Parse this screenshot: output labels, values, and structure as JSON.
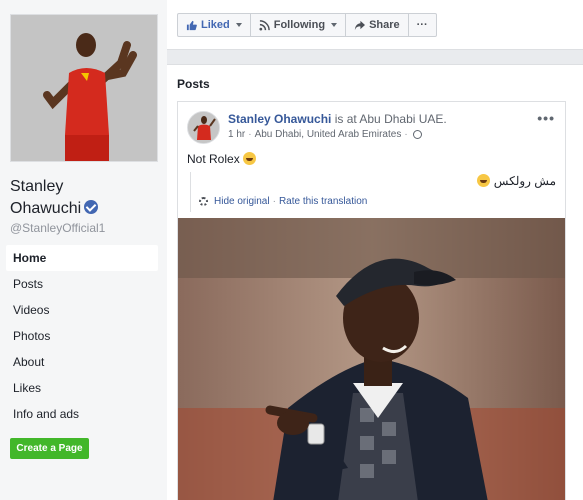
{
  "sidebar": {
    "page_name_first": "Stanley",
    "page_name_last": "Ohawuchi",
    "handle": "@StanleyOfficial1",
    "nav": [
      {
        "label": "Home"
      },
      {
        "label": "Posts"
      },
      {
        "label": "Videos"
      },
      {
        "label": "Photos"
      },
      {
        "label": "About"
      },
      {
        "label": "Likes"
      },
      {
        "label": "Info and ads"
      }
    ],
    "create_page_label": "Create a Page"
  },
  "actions": {
    "liked_label": "Liked",
    "following_label": "Following",
    "share_label": "Share",
    "more_label": "···"
  },
  "posts": {
    "heading": "Posts",
    "post": {
      "author": "Stanley Ohawuchi",
      "location_text": "is at Abu Dhabi UAE.",
      "time": "1 hr",
      "place": "Abu Dhabi, United Arab Emirates",
      "body": "Not Rolex",
      "translated_body": "مش رولكس",
      "hide_original_label": "Hide original",
      "rate_translation_label": "Rate this translation"
    }
  },
  "colors": {
    "brand_blue": "#4267b2",
    "link_blue": "#365899",
    "create_green": "#42b72a",
    "jersey_red": "#d42a1e"
  }
}
